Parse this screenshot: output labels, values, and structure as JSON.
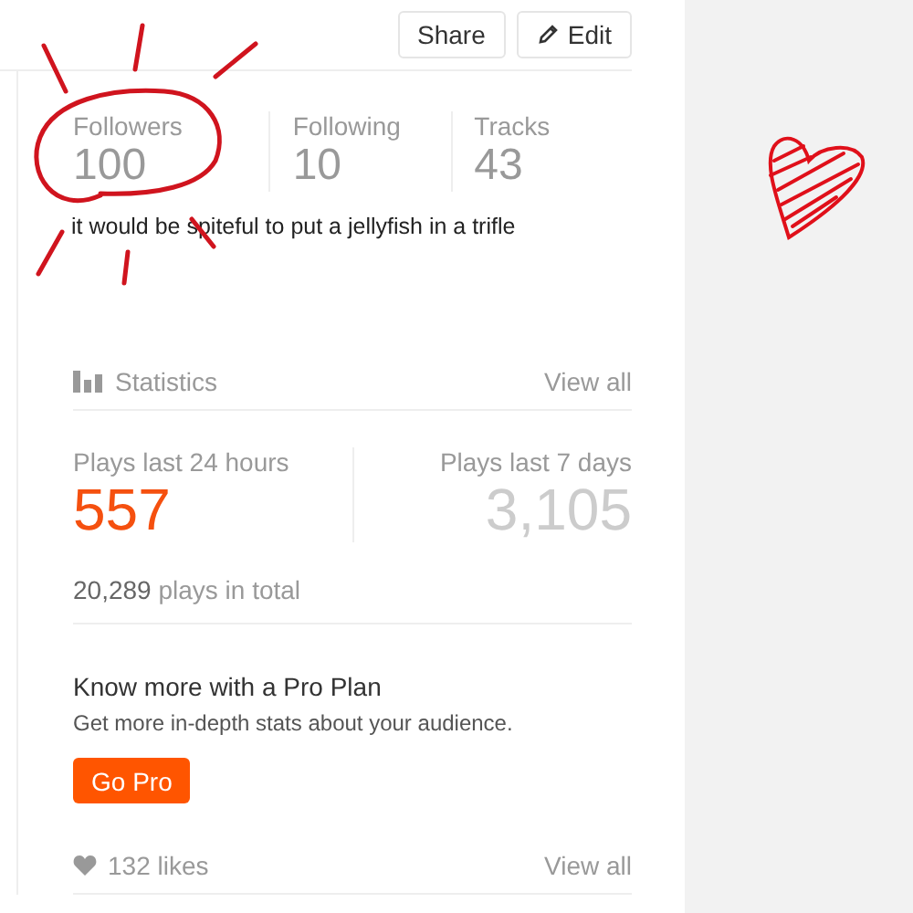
{
  "header": {
    "buttons": [
      {
        "kind": "share",
        "label": "Share"
      },
      {
        "kind": "edit",
        "label": "Edit"
      }
    ]
  },
  "profile_stats": [
    {
      "label": "Followers",
      "value": "100"
    },
    {
      "label": "Following",
      "value": "10"
    },
    {
      "label": "Tracks",
      "value": "43"
    }
  ],
  "bio": "it would be spiteful to put a jellyfish in a trifle",
  "statistics": {
    "title": "Statistics",
    "link": "View all",
    "plays": [
      {
        "label": "Plays last 24 hours",
        "value": "557",
        "highlight": true
      },
      {
        "label": "Plays last 7 days",
        "value": "3,105",
        "highlight": false
      }
    ],
    "total": "**20,289** plays in total"
  },
  "pro_plan": {
    "title": "Know more with a Pro Plan",
    "text": "Get more in-depth stats about your audience.",
    "button": "Go Pro"
  },
  "likes": {
    "count": "132 likes",
    "link": "View all"
  }
}
